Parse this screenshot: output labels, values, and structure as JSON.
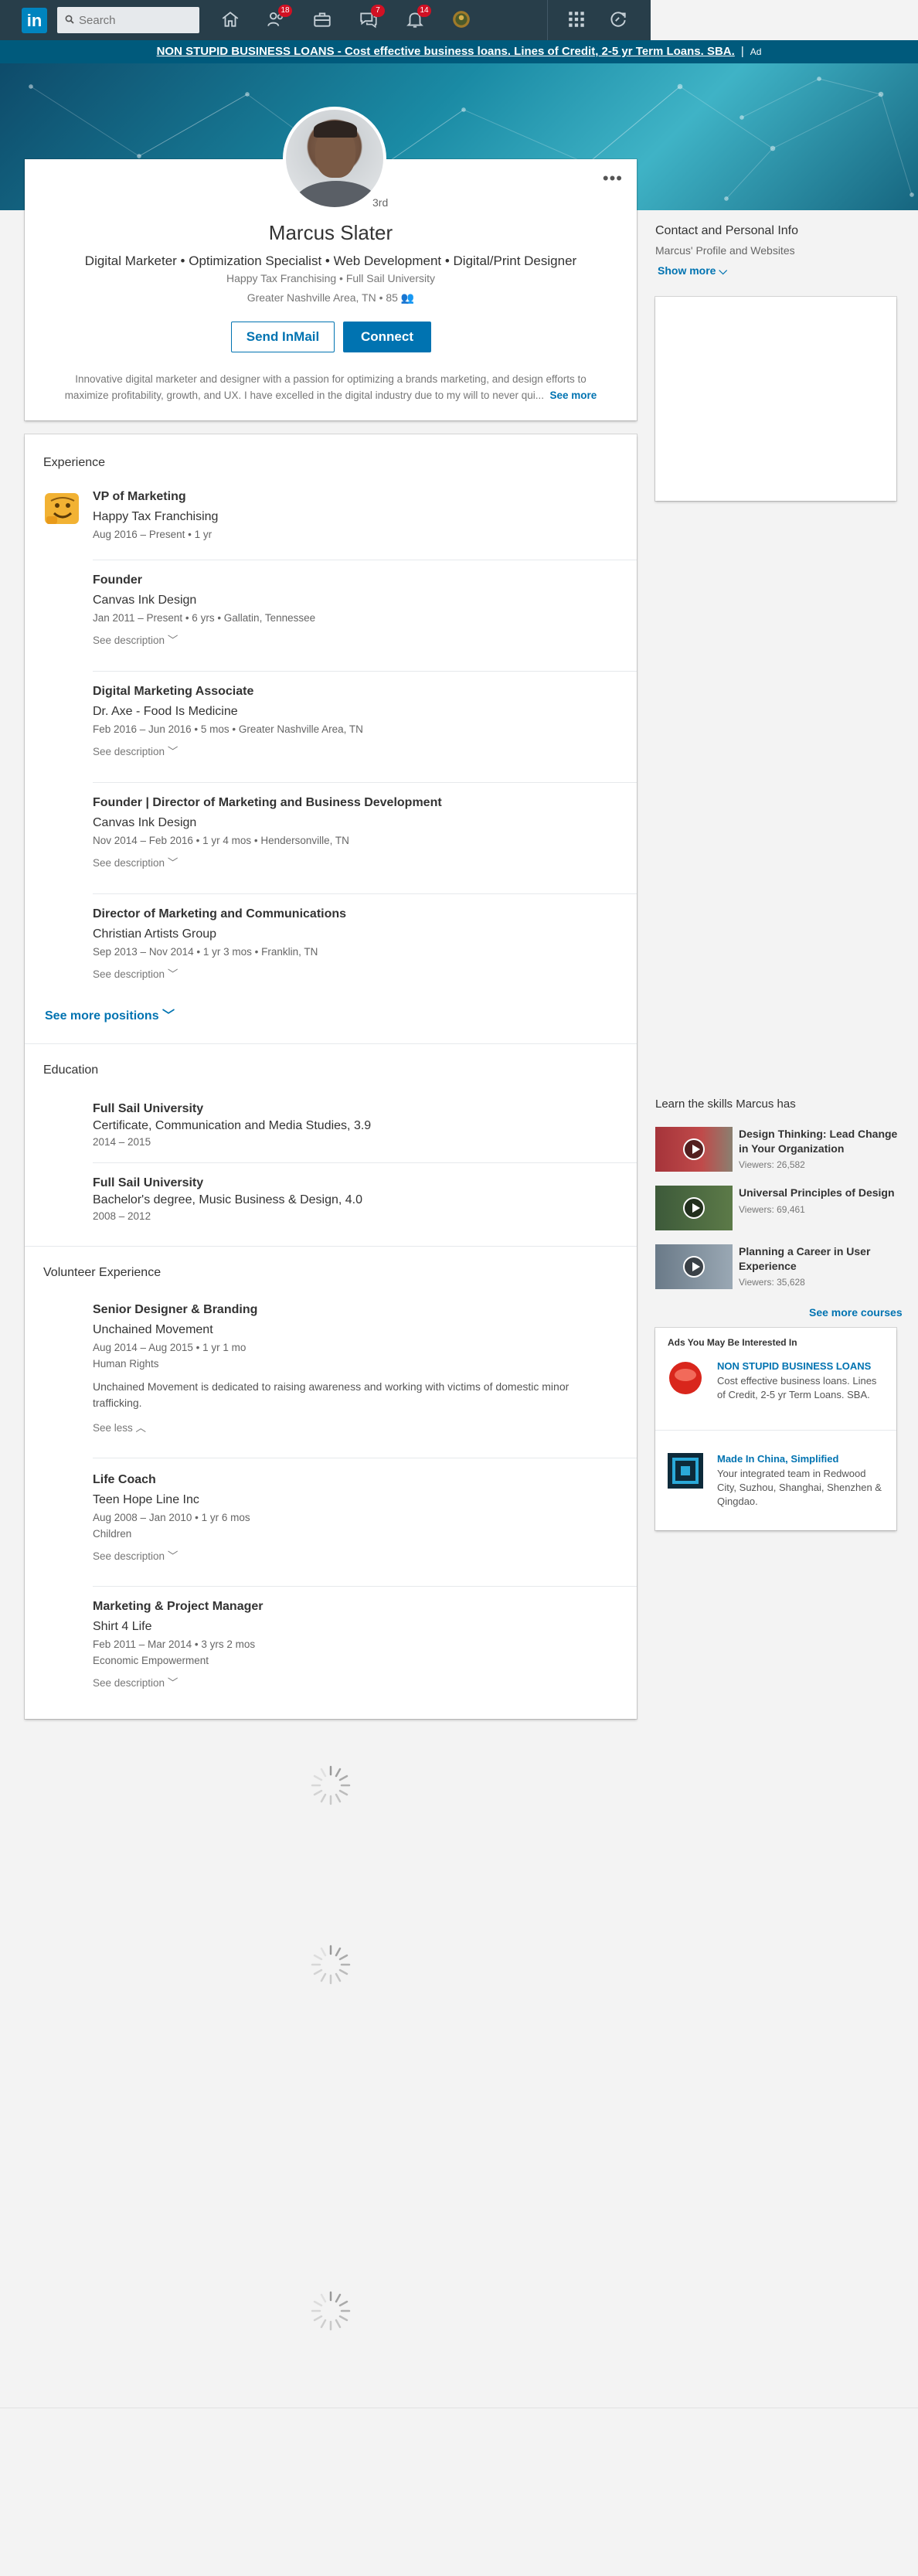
{
  "nav": {
    "logo": "in",
    "search_placeholder": "Search",
    "items": [
      {
        "name": "home-icon"
      },
      {
        "name": "my-network-icon",
        "badge": "18"
      },
      {
        "name": "jobs-icon"
      },
      {
        "name": "messaging-icon",
        "badge": "7"
      },
      {
        "name": "notifications-icon",
        "badge": "14"
      },
      {
        "name": "me-avatar-icon"
      }
    ],
    "work_icon": "grid-icon",
    "premium_icon": "premium-icon"
  },
  "ad_strip": {
    "text": "NON STUPID BUSINESS LOANS - Cost effective business loans. Lines of Credit, 2-5 yr Term Loans. SBA.",
    "separator": "|",
    "tag": "Ad"
  },
  "profile": {
    "degree": "3rd",
    "name": "Marcus Slater",
    "headline": "Digital Marketer • Optimization Specialist • Web Development • Digital/Print Designer",
    "company_line": "Happy Tax Franchising • Full Sail University",
    "location_line": "Greater Nashville Area, TN • 85",
    "send_inmail": "Send InMail",
    "connect": "Connect",
    "summary_1": "Innovative digital marketer and designer with a passion for optimizing a brands marketing, and design efforts to",
    "summary_2": "maximize profitability, growth, and UX. I have excelled in the digital industry due to my will to never qui...",
    "see_more": "See more"
  },
  "right_rail": {
    "contact_title": "Contact and Personal Info",
    "contact_sub": "Marcus' Profile and Websites",
    "show_more": "Show more",
    "learn_title": "Learn the skills Marcus has",
    "courses": [
      {
        "title": "Design Thinking: Lead Change in Your Organization",
        "viewers": "Viewers: 26,582"
      },
      {
        "title": "Universal Principles of Design",
        "viewers": "Viewers: 69,461"
      },
      {
        "title": "Planning a Career in User Experience",
        "viewers": "Viewers: 35,628"
      }
    ],
    "see_more_courses": "See more courses",
    "ads_title": "Ads You May Be Interested In",
    "ads": [
      {
        "name": "NON STUPID BUSINESS LOANS",
        "desc": "Cost effective business loans. Lines of Credit, 2-5 yr Term Loans. SBA."
      },
      {
        "name": "Made In China, Simplified",
        "desc": "Your integrated team in Redwood City, Suzhou, Shanghai, Shenzhen & Qingdao."
      }
    ]
  },
  "experience": {
    "title": "Experience",
    "items": [
      {
        "title": "VP of Marketing",
        "company": "Happy Tax Franchising",
        "dates": "Aug 2016 – Present • 1 yr"
      },
      {
        "title": "Founder",
        "company": "Canvas Ink Design",
        "dates": "Jan 2011 – Present • 6 yrs • Gallatin, Tennessee",
        "see": "See description"
      },
      {
        "title": "Digital Marketing Associate",
        "company": "Dr. Axe - Food Is Medicine",
        "dates": "Feb 2016 – Jun 2016 • 5 mos • Greater Nashville Area, TN",
        "see": "See description"
      },
      {
        "title": "Founder | Director of Marketing and Business Development",
        "company": "Canvas Ink Design",
        "dates": "Nov 2014 – Feb 2016 • 1 yr 4 mos • Hendersonville, TN",
        "see": "See description"
      },
      {
        "title": "Director of Marketing and Communications",
        "company": "Christian Artists Group",
        "dates": "Sep 2013 – Nov 2014 • 1 yr 3 mos • Franklin, TN",
        "see": "See description"
      }
    ],
    "see_more_positions": "See more positions"
  },
  "education": {
    "title": "Education",
    "items": [
      {
        "school": "Full Sail University",
        "degree": "Certificate, Communication and Media Studies, 3.9",
        "dates": "2014 – 2015"
      },
      {
        "school": "Full Sail University",
        "degree": "Bachelor's degree, Music Business & Design, 4.0",
        "dates": "2008 – 2012"
      }
    ]
  },
  "volunteer": {
    "title": "Volunteer Experience",
    "items": [
      {
        "title": "Senior Designer & Branding",
        "org": "Unchained Movement",
        "dates": "Aug 2014 – Aug 2015 • 1 yr 1 mo",
        "cause": "Human Rights",
        "desc_1": "Unchained Movement is dedicated to raising awareness and working with victims of domestic minor",
        "desc_2": "trafficking.",
        "see": "See less"
      },
      {
        "title": "Life Coach",
        "org": "Teen Hope Line Inc",
        "dates": "Aug 2008 – Jan 2010 • 1 yr 6 mos",
        "cause": "Children",
        "see": "See description"
      },
      {
        "title": "Marketing & Project Manager",
        "org": "Shirt 4 Life",
        "dates": "Feb 2011 – Mar 2014 • 3 yrs 2 mos",
        "cause": "Economic Empowerment",
        "see": "See description"
      }
    ]
  },
  "colors": {
    "brand": "#0073b1",
    "nav": "#283e4a",
    "badge": "#d11124"
  }
}
